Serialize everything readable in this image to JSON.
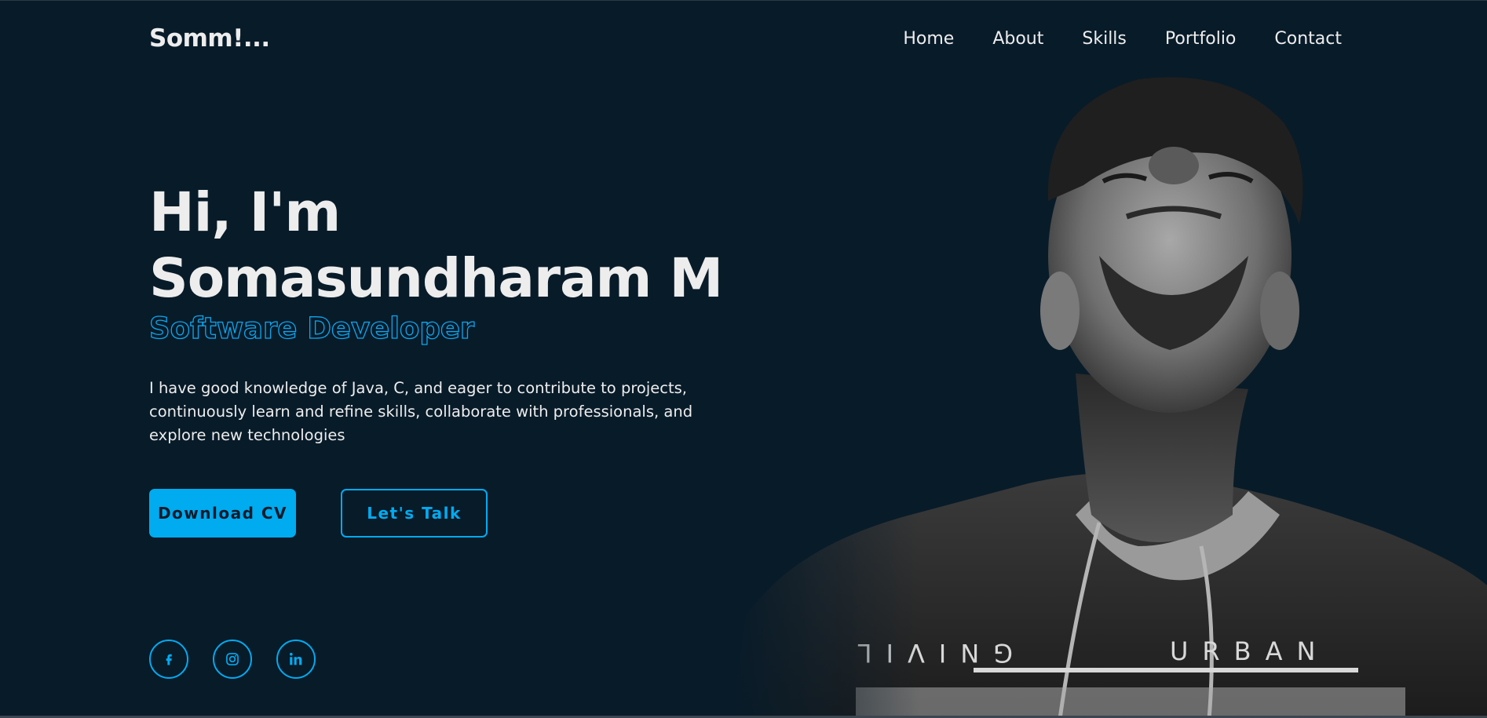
{
  "header": {
    "logo": "Somm!...",
    "nav": [
      {
        "label": "Home"
      },
      {
        "label": "About"
      },
      {
        "label": "Skills"
      },
      {
        "label": "Portfolio"
      },
      {
        "label": "Contact"
      }
    ]
  },
  "hero": {
    "greeting_line1": "Hi, I'm",
    "greeting_line2": "Somasundharam M",
    "role": "Software Developer",
    "description": "I have good knowledge of Java, C, and eager to contribute to projects, continuously learn and refine skills, collaborate with professionals, and explore new technologies",
    "download_button": "Download CV",
    "talk_button": "Let's Talk",
    "portrait_shirt_text": "URBAN LIVING"
  },
  "socials": [
    {
      "icon": "facebook-icon"
    },
    {
      "icon": "instagram-icon"
    },
    {
      "icon": "linkedin-icon"
    }
  ],
  "colors": {
    "background": "#081b29",
    "accent": "#00abf0",
    "text": "#ededed"
  }
}
